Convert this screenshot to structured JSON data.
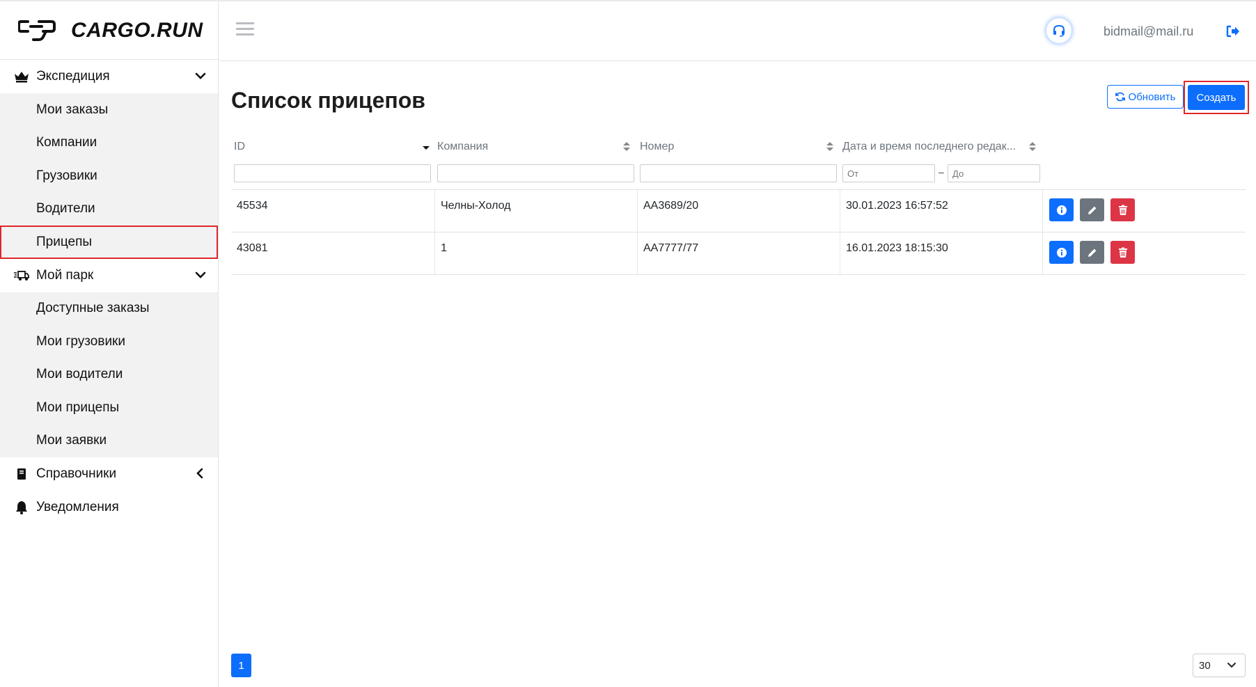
{
  "brand": {
    "name": "CARGO.RUN"
  },
  "sidebar": {
    "groups": [
      {
        "label": "Экспедиция",
        "icon": "crown-icon",
        "expanded": true,
        "items": [
          {
            "label": "Мои заказы"
          },
          {
            "label": "Компании"
          },
          {
            "label": "Грузовики"
          },
          {
            "label": "Водители"
          },
          {
            "label": "Прицепы",
            "active": true
          }
        ]
      },
      {
        "label": "Мой парк",
        "icon": "truck-fast-icon",
        "expanded": true,
        "items": [
          {
            "label": "Доступные заказы"
          },
          {
            "label": "Мои грузовики"
          },
          {
            "label": "Мои водители"
          },
          {
            "label": "Мои прицепы"
          },
          {
            "label": "Мои заявки"
          }
        ]
      },
      {
        "label": "Справочники",
        "icon": "book-icon",
        "expanded": false
      },
      {
        "label": "Уведомления",
        "icon": "bell-icon"
      }
    ]
  },
  "header": {
    "user_email": "bidmail@mail.ru"
  },
  "main": {
    "title": "Список прицепов",
    "refresh_label": "Обновить",
    "create_label": "Создать",
    "columns": [
      {
        "label": "ID"
      },
      {
        "label": "Компания"
      },
      {
        "label": "Номер"
      },
      {
        "label": "Дата и время последнего редак..."
      }
    ],
    "filters": {
      "date_from_placeholder": "От",
      "date_to_placeholder": "До",
      "range_separator": "–"
    },
    "rows": [
      {
        "id": "45534",
        "company": "Челны-Холод",
        "number": "АА3689/20",
        "updated": "30.01.2023 16:57:52"
      },
      {
        "id": "43081",
        "company": "1",
        "number": "АА7777/77",
        "updated": "16.01.2023 18:15:30"
      }
    ]
  },
  "pagination": {
    "current_page": "1",
    "per_page": "30"
  },
  "colors": {
    "primary": "#0d6efd",
    "secondary": "#6c757d",
    "danger": "#dc3545",
    "highlight": "#e0262b"
  }
}
